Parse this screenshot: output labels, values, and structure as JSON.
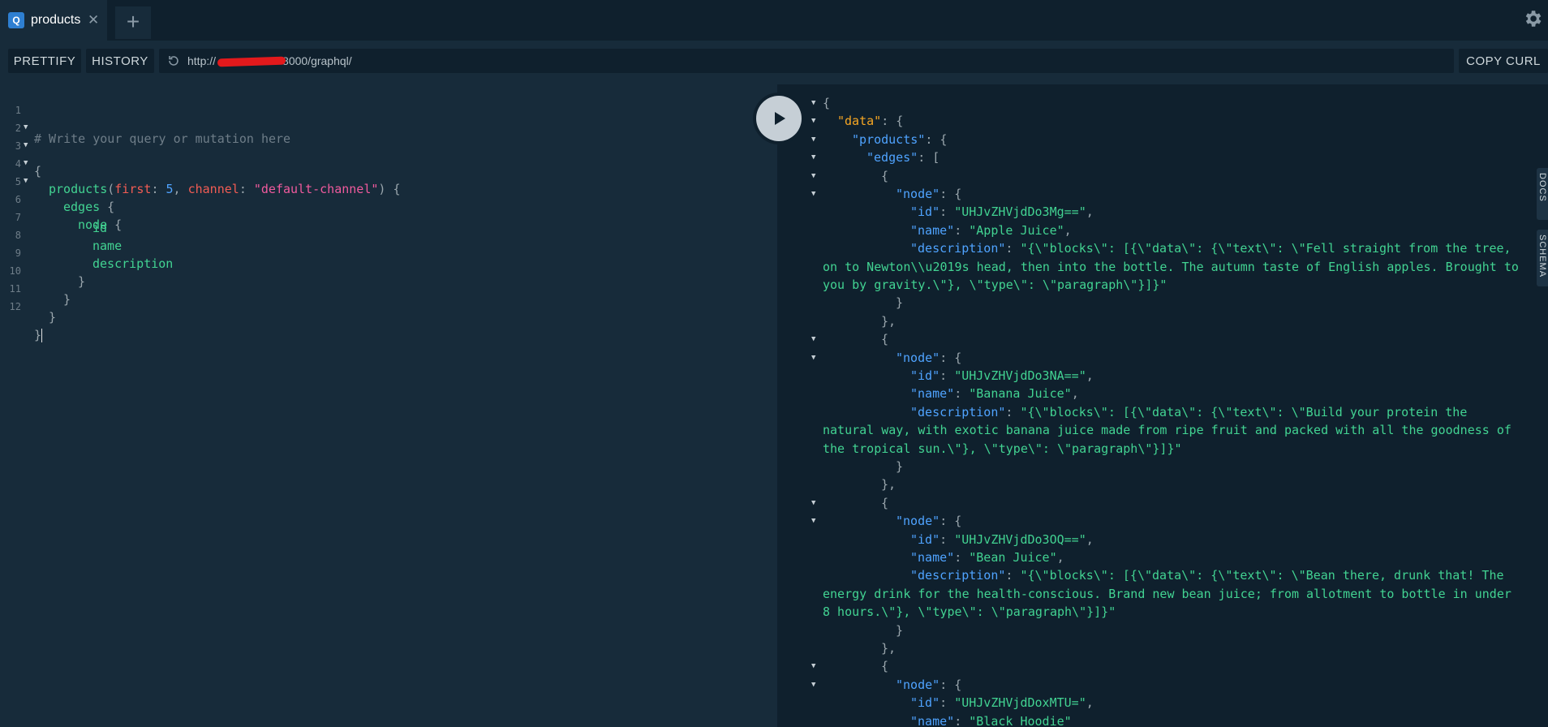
{
  "tabs": [
    {
      "badge": "Q",
      "title": "products"
    }
  ],
  "toolbar": {
    "prettify_label": "PRETTIFY",
    "history_label": "HISTORY",
    "url": "http://",
    "url_suffix": "8000/graphql/",
    "copy_curl_label": "COPY CURL"
  },
  "side_tabs": {
    "docs": "DOCS",
    "schema": "SCHEMA"
  },
  "editor": {
    "line_numbers": [
      "1",
      "2",
      "3",
      "4",
      "5",
      "6",
      "7",
      "8",
      "9",
      "10",
      "11",
      "12"
    ],
    "comment": "# Write your query or mutation here",
    "open_brace": "{",
    "query_field": "products",
    "arg1_name": "first",
    "arg1_value": "5",
    "arg2_name": "channel",
    "arg2_value": "\"default-channel\"",
    "edges": "edges",
    "node": "node",
    "fields": [
      "id",
      "name",
      "description"
    ],
    "close_brace": "}"
  },
  "result": {
    "lines": [
      {
        "t": "p",
        "text": "{",
        "fold": true
      },
      {
        "t": "k",
        "key": "\"data\"",
        "rest": ": {",
        "data": true,
        "fold": true,
        "indent": 1
      },
      {
        "t": "k",
        "key": "\"products\"",
        "rest": ": {",
        "fold": true,
        "indent": 2
      },
      {
        "t": "k",
        "key": "\"edges\"",
        "rest": ": [",
        "fold": true,
        "indent": 3
      },
      {
        "t": "p",
        "text": "{",
        "fold": true,
        "indent": 4
      },
      {
        "t": "k",
        "key": "\"node\"",
        "rest": ": {",
        "fold": true,
        "indent": 5
      },
      {
        "t": "kv",
        "key": "\"id\"",
        "val": "\"UHJvZHVjdDo3Mg==\"",
        "indent": 6
      },
      {
        "t": "kv",
        "key": "\"name\"",
        "val": "\"Apple Juice\"",
        "indent": 6
      },
      {
        "t": "kv",
        "key": "\"description\"",
        "val": "\"{\\\"blocks\\\": [{\\\"data\\\": {\\\"text\\\": \\\"Fell straight from the tree,",
        "indent": 6
      },
      {
        "t": "s",
        "text": "on to Newton\\\\u2019s head, then into the bottle. The autumn taste of English apples. Brought to",
        "indent": 0
      },
      {
        "t": "s",
        "text": "you by gravity.\\\"}, \\\"type\\\": \\\"paragraph\\\"}]}\"",
        "indent": 0
      },
      {
        "t": "p",
        "text": "}",
        "indent": 5
      },
      {
        "t": "p",
        "text": "},",
        "indent": 4
      },
      {
        "t": "p",
        "text": "{",
        "fold": true,
        "indent": 4
      },
      {
        "t": "k",
        "key": "\"node\"",
        "rest": ": {",
        "fold": true,
        "indent": 5
      },
      {
        "t": "kv",
        "key": "\"id\"",
        "val": "\"UHJvZHVjdDo3NA==\"",
        "indent": 6
      },
      {
        "t": "kv",
        "key": "\"name\"",
        "val": "\"Banana Juice\"",
        "indent": 6
      },
      {
        "t": "kv",
        "key": "\"description\"",
        "val": "\"{\\\"blocks\\\": [{\\\"data\\\": {\\\"text\\\": \\\"Build your protein the",
        "indent": 6
      },
      {
        "t": "s",
        "text": "natural way, with exotic banana juice made from ripe fruit and packed with all the goodness of",
        "indent": 0
      },
      {
        "t": "s",
        "text": "the tropical sun.\\\"}, \\\"type\\\": \\\"paragraph\\\"}]}\"",
        "indent": 0
      },
      {
        "t": "p",
        "text": "}",
        "indent": 5
      },
      {
        "t": "p",
        "text": "},",
        "indent": 4
      },
      {
        "t": "p",
        "text": "{",
        "fold": true,
        "indent": 4
      },
      {
        "t": "k",
        "key": "\"node\"",
        "rest": ": {",
        "fold": true,
        "indent": 5
      },
      {
        "t": "kv",
        "key": "\"id\"",
        "val": "\"UHJvZHVjdDo3OQ==\"",
        "indent": 6
      },
      {
        "t": "kv",
        "key": "\"name\"",
        "val": "\"Bean Juice\"",
        "indent": 6
      },
      {
        "t": "kv",
        "key": "\"description\"",
        "val": "\"{\\\"blocks\\\": [{\\\"data\\\": {\\\"text\\\": \\\"Bean there, drunk that! The",
        "indent": 6
      },
      {
        "t": "s",
        "text": "energy drink for the health-conscious. Brand new bean juice; from allotment to bottle in under",
        "indent": 0
      },
      {
        "t": "s",
        "text": "8 hours.\\\"}, \\\"type\\\": \\\"paragraph\\\"}]}\"",
        "indent": 0
      },
      {
        "t": "p",
        "text": "}",
        "indent": 5
      },
      {
        "t": "p",
        "text": "},",
        "indent": 4
      },
      {
        "t": "p",
        "text": "{",
        "fold": true,
        "indent": 4
      },
      {
        "t": "k",
        "key": "\"node\"",
        "rest": ": {",
        "fold": true,
        "indent": 5
      },
      {
        "t": "kv",
        "key": "\"id\"",
        "val": "\"UHJvZHVjdDoxMTU=\"",
        "indent": 6
      },
      {
        "t": "kv",
        "key": "\"name\"",
        "val": "\"Black Hoodie\"",
        "indent": 6
      }
    ]
  }
}
